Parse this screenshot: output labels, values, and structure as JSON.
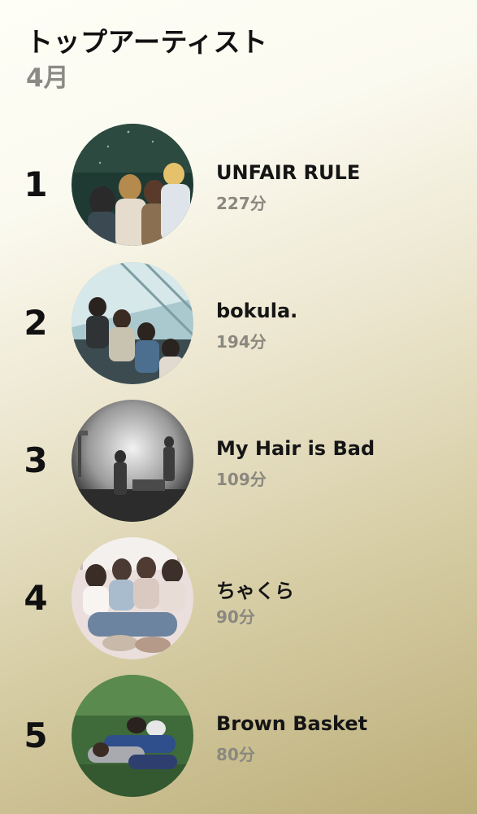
{
  "header": {
    "title": "トップアーティスト",
    "subtitle": "4月"
  },
  "artists": [
    {
      "rank": "1",
      "name": "UNFAIR RULE",
      "minutes": "227分"
    },
    {
      "rank": "2",
      "name": "bokula.",
      "minutes": "194分"
    },
    {
      "rank": "3",
      "name": "My Hair is Bad",
      "minutes": "109分"
    },
    {
      "rank": "4",
      "name": "ちゃくら",
      "minutes": "90分"
    },
    {
      "rank": "5",
      "name": "Brown Basket",
      "minutes": "80分"
    }
  ]
}
